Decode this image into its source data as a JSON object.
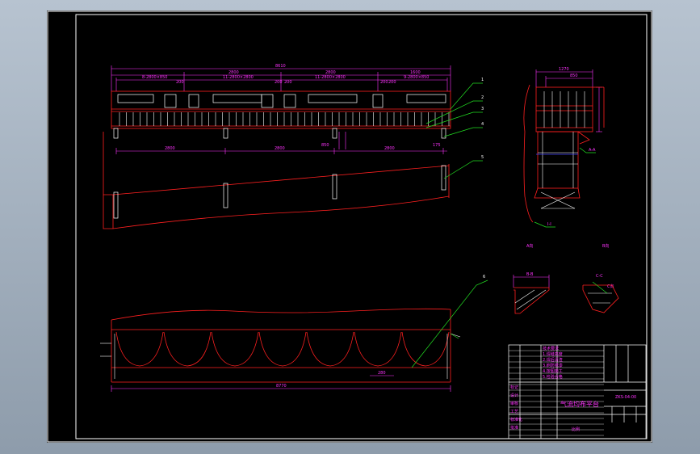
{
  "colors": {
    "background": "#000000",
    "frame": "#ffffff",
    "profile": "#ff2020",
    "dimension": "#ff33ff",
    "leader": "#22dd22",
    "hidden": "#4444ff"
  },
  "dimensions": {
    "top_overall": "8610",
    "span_1": "2800",
    "span_2": "2800",
    "span_3": "1600",
    "span_a": "8-2800×850",
    "span_b": "11-2800×2800",
    "span_c": "11-2800×2800",
    "span_d": "9-2800×850",
    "small_1": "200",
    "small_2": "200",
    "small_3": "200",
    "small_4": "200",
    "small_5": "200",
    "low_1": "2800",
    "low_2": "2800",
    "low_3": "2800",
    "low_4": "175",
    "mid_mark": "850",
    "side_top": "1270",
    "side_sub": "850",
    "bottom_overall": "8770",
    "bottom_mid": "280"
  },
  "callouts": [
    "1",
    "2",
    "3",
    "4",
    "5",
    "6"
  ],
  "section_labels": {
    "section_a": "A-A",
    "section_b": "I-I",
    "detail_left": "B-B",
    "detail_right": "C-C",
    "view_1": "A向",
    "view_2": "B向",
    "view_3": "C向"
  },
  "title_block": {
    "drawing_title": "气流均布平台",
    "drawing_code": "ZKS-04-00",
    "notes_lines": [
      "技术要求",
      "1.焊缝高度",
      "2.焊后清渣",
      "3.刷防锈漆",
      "4.按图施工",
      "5.检验合格"
    ],
    "left_column": [
      "标记",
      "设计",
      "审核",
      "工艺",
      "标准化",
      "批准"
    ],
    "footer_note": "比例"
  }
}
